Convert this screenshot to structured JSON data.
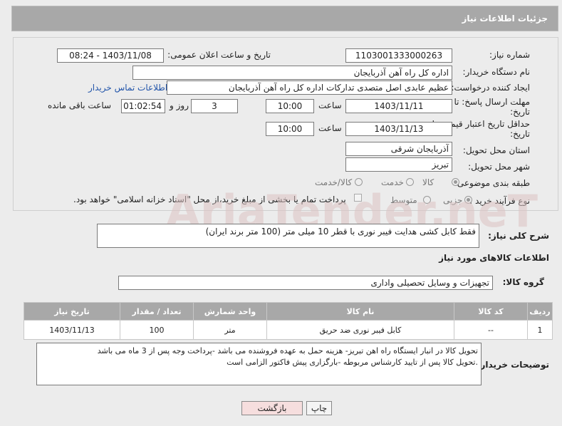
{
  "header": {
    "title": "جزئیات اطلاعات نیاز"
  },
  "form": {
    "need_number_label": "شماره نیاز:",
    "need_number": "1103001333000263",
    "announce_label": "تاریخ و ساعت اعلان عمومی:",
    "announce_value": "1403/11/08 - 08:24",
    "buyer_org_label": "نام دستگاه خریدار:",
    "buyer_org": "اداره کل راه آهن آذربایجان",
    "creator_label": "ایجاد کننده درخواست:",
    "creator": "عظیم عابدی اصل متصدی تدارکات اداره کل راه آهن آذربایجان",
    "contact_link": "اطلاعات تماس خریدار",
    "reply_deadline_label": "مهلت ارسال پاسخ: تا",
    "reply_deadline_label2": "تاریخ:",
    "reply_date": "1403/11/11",
    "time_label": "ساعت",
    "reply_time": "10:00",
    "days_value": "3",
    "days_label": "روز و",
    "remaining_value": "01:02:54",
    "remaining_label": "ساعت باقی مانده",
    "price_validity_label": "حداقل تاریخ اعتبار قیمت: تا",
    "price_validity_label2": "تاریخ:",
    "price_date": "1403/11/13",
    "price_time": "10:00",
    "province_label": "استان محل تحویل:",
    "province": "آذربایجان شرقی",
    "city_label": "شهر محل تحویل:",
    "city": "تبریز",
    "category_label": "طبقه بندی موضوعی:",
    "category_options": [
      "کالا",
      "خدمت",
      "کالا/خدمت"
    ],
    "purchase_type_label": "نوع فرآیند خرید :",
    "purchase_options": [
      "جزیی",
      "متوسط"
    ],
    "payment_note": "پرداخت تمام یا بخشی از مبلغ خرید،از محل \"اسناد خزانه اسلامی\" خواهد بود."
  },
  "summary": {
    "label": "شرح کلی نیاز:",
    "value": "فقط کابل کشی هدایت فیبر نوری با قطر 10 میلی متر (100 متر برند ایران)"
  },
  "goods": {
    "section_title": "اطلاعات کالاهای مورد نیاز",
    "group_label": "گروه کالا:",
    "group_value": "تجهیزات و وسایل تحصیلی واداری",
    "columns": [
      "ردیف",
      "کد کالا",
      "نام کالا",
      "واحد شمارش",
      "تعداد / مقدار",
      "تاریخ نیاز"
    ],
    "rows": [
      [
        "1",
        "--",
        "کابل فیبر نوری ضد حریق",
        "متر",
        "100",
        "1403/11/13"
      ]
    ]
  },
  "notes": {
    "label": "توضیحات خریدار:",
    "line1": "تحویل کالا در انبار ایستگاه راه اهن تبریز- هزینه حمل به عهده  فروشنده می باشد -پرداخت وجه پس از 3 ماه می باشد",
    "line2": ".تحویل کالا پس از تایید کارشناس مربوطه -بارگزاری پیش فاکتور الزامی است"
  },
  "buttons": {
    "print": "چاپ",
    "back": "بازگشت"
  },
  "watermark": {
    "text": "AriaTender.neT"
  },
  "colors": {
    "header_bg": "#a8a8a8",
    "link": "#2255aa",
    "watermark": "#d9b9b9",
    "back_btn": "#f6dede"
  }
}
